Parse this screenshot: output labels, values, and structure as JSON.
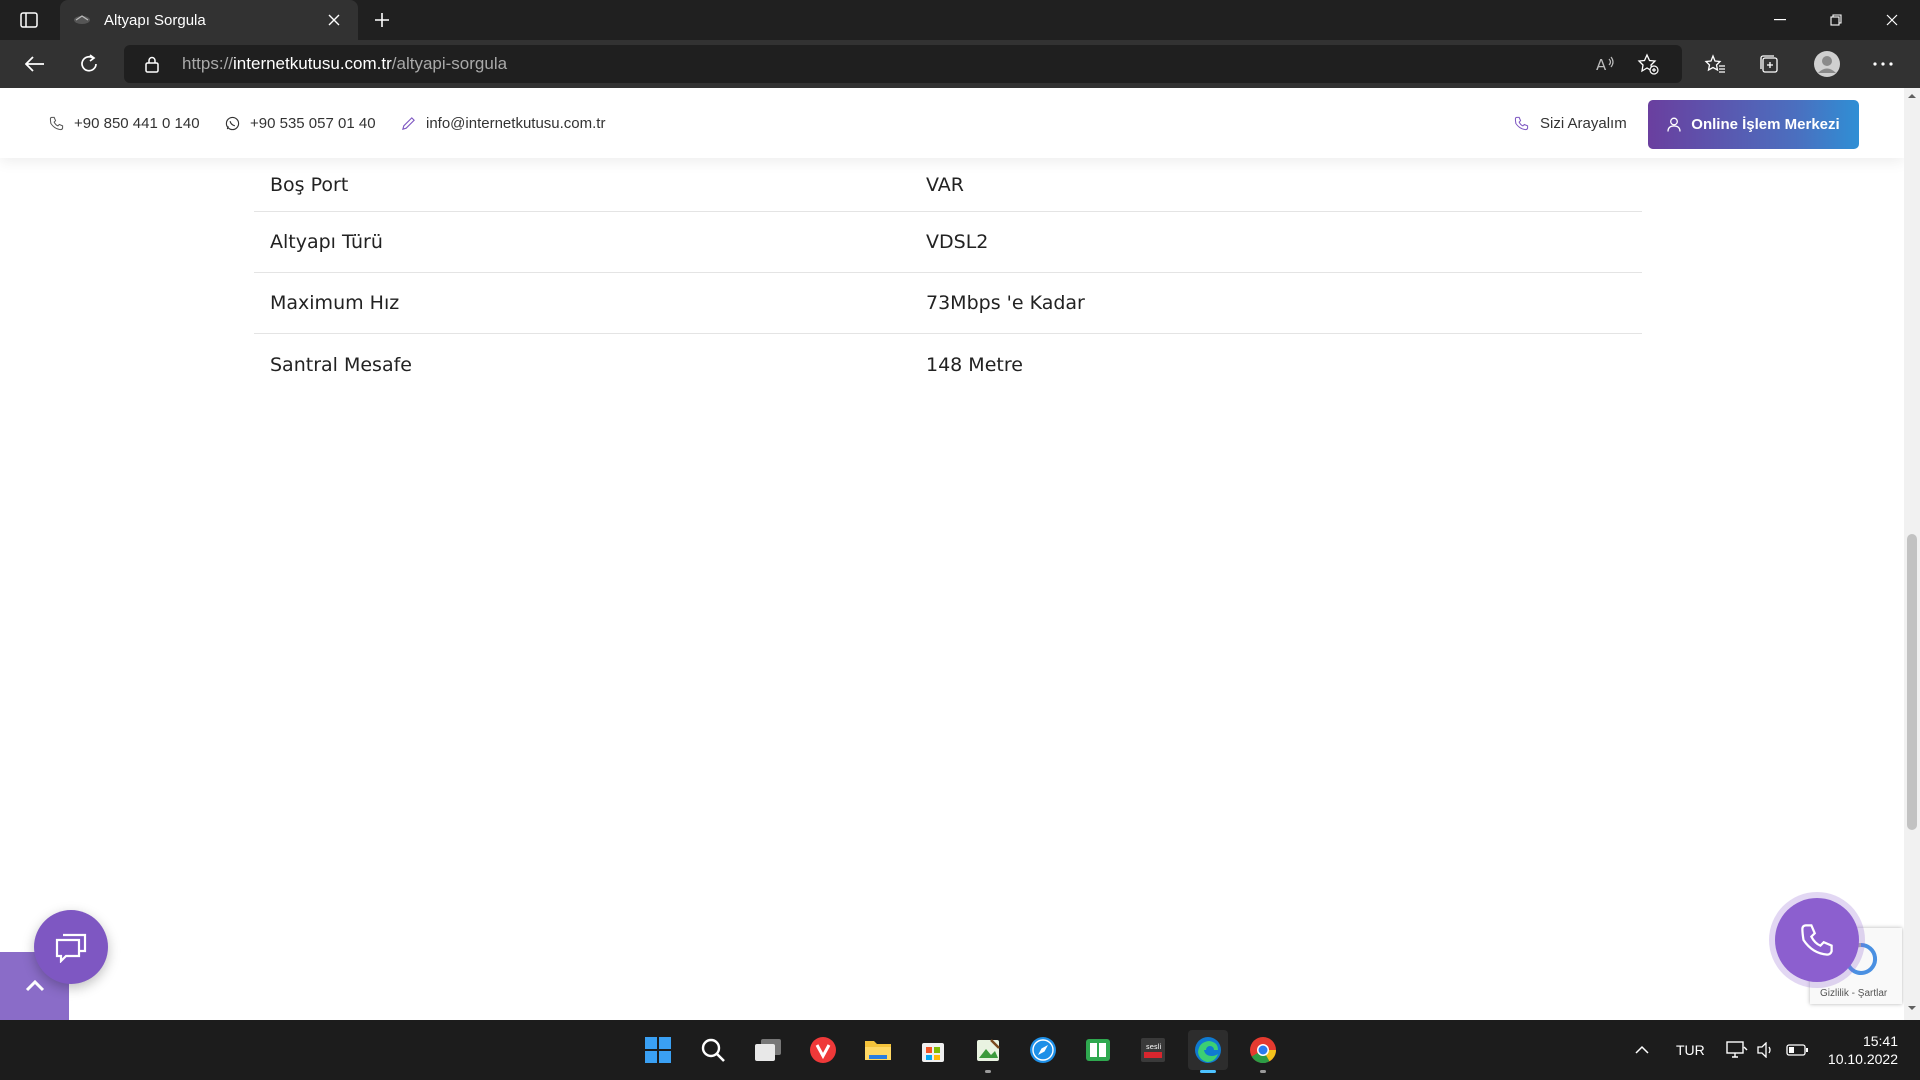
{
  "browser": {
    "tab_title": "Altyapı Sorgula",
    "url_scheme": "https://",
    "url_host": "internetkutusu.com.tr",
    "url_path": "/altyapi-sorgula"
  },
  "header": {
    "phone1": "+90 850 441 0 140",
    "phone2": "+90 535 057 01 40",
    "email": "info@internetkutusu.com.tr",
    "call_me": "Sizi Arayalım",
    "online_center": "Online İşlem Merkezi"
  },
  "info_rows": [
    {
      "label": "Boş Port",
      "value": "VAR"
    },
    {
      "label": "Altyapı Türü",
      "value": "VDSL2"
    },
    {
      "label": "Maximum Hız",
      "value": "73Mbps 'e Kadar"
    },
    {
      "label": "Santral Mesafe",
      "value": "148 Metre"
    }
  ],
  "recaptcha": {
    "text": "Gizlilik - Şartlar"
  },
  "taskbar": {
    "lang": "TUR",
    "time": "15:41",
    "date": "10.10.2022"
  },
  "colors": {
    "brand_purple": "#7e57c2",
    "button_gradient_start": "#6a3f9f",
    "button_gradient_end": "#2f8fd5"
  }
}
